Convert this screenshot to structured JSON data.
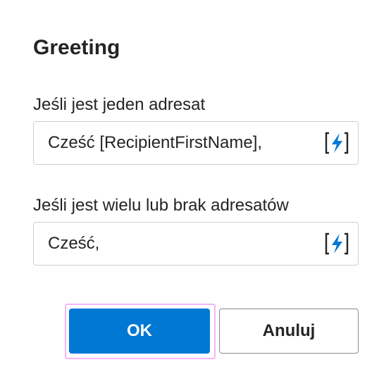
{
  "dialog": {
    "title": "Greeting"
  },
  "fields": [
    {
      "label": "Jeśli jest jeden adresat",
      "value": "Cześć [RecipientFirstName],",
      "insert_icon": "insert-merge-field-icon"
    },
    {
      "label": "Jeśli jest wielu lub brak adresatów",
      "value": "Cześć,",
      "insert_icon": "insert-merge-field-icon"
    }
  ],
  "buttons": {
    "ok_label": "OK",
    "cancel_label": "Anuluj"
  },
  "colors": {
    "primary": "#0078d4",
    "focus_ring": "#f2b6f5",
    "text": "#242424",
    "border": "#cfcfcf"
  }
}
